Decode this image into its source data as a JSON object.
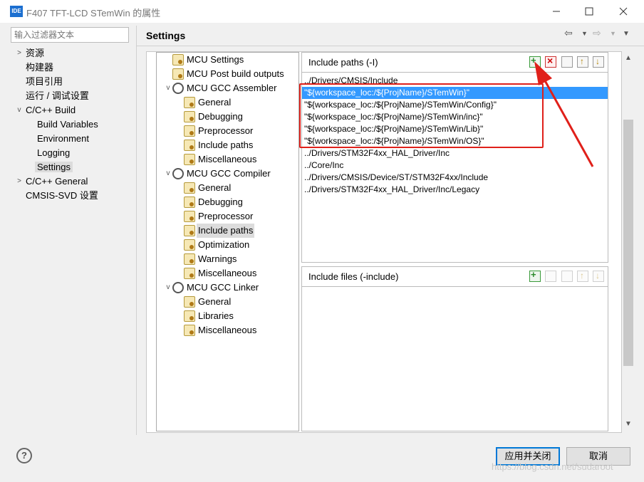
{
  "window": {
    "title": "F407 TFT-LCD STemWin 的属性",
    "app_icon": "IDE"
  },
  "filter": {
    "placeholder": "输入过滤器文本"
  },
  "nav": {
    "items": [
      {
        "label": "资源",
        "expanded": false
      },
      {
        "label": "构建器"
      },
      {
        "label": "项目引用"
      },
      {
        "label": "运行 / 调试设置"
      },
      {
        "label": "C/C++ Build",
        "expanded": true
      },
      {
        "label": "Build Variables"
      },
      {
        "label": "Environment"
      },
      {
        "label": "Logging"
      },
      {
        "label": "Settings",
        "selected": true
      },
      {
        "label": "C/C++ General",
        "expanded": false
      },
      {
        "label": "CMSIS-SVD 设置"
      }
    ]
  },
  "page": {
    "title": "Settings"
  },
  "tool_tree": {
    "items": [
      {
        "label": "MCU Settings",
        "icon": "doc-icon"
      },
      {
        "label": "MCU Post build outputs",
        "icon": "doc-icon"
      },
      {
        "label": "MCU GCC Assembler",
        "icon": "gear-icon",
        "expanded": true
      },
      {
        "label": "General",
        "icon": "doc-icon"
      },
      {
        "label": "Debugging",
        "icon": "doc-icon"
      },
      {
        "label": "Preprocessor",
        "icon": "doc-icon"
      },
      {
        "label": "Include paths",
        "icon": "doc-icon"
      },
      {
        "label": "Miscellaneous",
        "icon": "doc-icon"
      },
      {
        "label": "MCU GCC Compiler",
        "icon": "gear-icon",
        "expanded": true
      },
      {
        "label": "General",
        "icon": "doc-icon"
      },
      {
        "label": "Debugging",
        "icon": "doc-icon"
      },
      {
        "label": "Preprocessor",
        "icon": "doc-icon"
      },
      {
        "label": "Include paths",
        "icon": "doc-icon",
        "selected": true
      },
      {
        "label": "Optimization",
        "icon": "doc-icon"
      },
      {
        "label": "Warnings",
        "icon": "doc-icon"
      },
      {
        "label": "Miscellaneous",
        "icon": "doc-icon"
      },
      {
        "label": "MCU GCC Linker",
        "icon": "gear-icon",
        "expanded": true
      },
      {
        "label": "General",
        "icon": "doc-icon"
      },
      {
        "label": "Libraries",
        "icon": "doc-icon"
      },
      {
        "label": "Miscellaneous",
        "icon": "doc-icon"
      }
    ]
  },
  "include_paths": {
    "title": "Include paths (-I)",
    "items": [
      "../Drivers/CMSIS/Include",
      "\"${workspace_loc:/${ProjName}/STemWin}\"",
      "\"${workspace_loc:/${ProjName}/STemWin/Config}\"",
      "\"${workspace_loc:/${ProjName}/STemWin/inc}\"",
      "\"${workspace_loc:/${ProjName}/STemWin/Lib}\"",
      "\"${workspace_loc:/${ProjName}/STemWin/OS}\"",
      "../Drivers/STM32F4xx_HAL_Driver/Inc",
      "../Core/Inc",
      "../Drivers/CMSIS/Device/ST/STM32F4xx/Include",
      "../Drivers/STM32F4xx_HAL_Driver/Inc/Legacy"
    ],
    "selected_index": 1
  },
  "include_files": {
    "title": "Include files (-include)",
    "items": []
  },
  "buttons": {
    "apply_close": "应用并关闭",
    "cancel": "取消",
    "help": "?"
  },
  "watermark": "https://blog.csdn.net/sudaroot",
  "colors": {
    "selection": "#3399ff",
    "annotation": "#e0201a",
    "primary_button_border": "#0078d7"
  }
}
